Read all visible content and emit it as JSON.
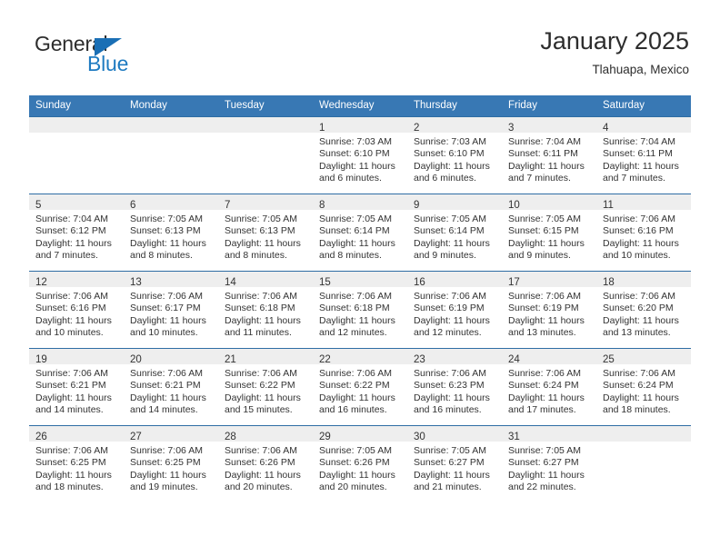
{
  "brand": {
    "logo_top": "General",
    "logo_bottom": "Blue",
    "accent_color": "#1f7bc1",
    "triangle_color": "#1a6fb5",
    "triangle_icon": "triangle-icon"
  },
  "header": {
    "title": "January 2025",
    "subtitle": "Tlahuapa, Mexico"
  },
  "calendar": {
    "header_bg": "#3878b4",
    "header_text_color": "#ffffff",
    "daynum_band_bg": "#eeeeee",
    "row_border_color": "#2e6da4",
    "weekday_headers": [
      "Sunday",
      "Monday",
      "Tuesday",
      "Wednesday",
      "Thursday",
      "Friday",
      "Saturday"
    ],
    "weeks": [
      [
        {
          "day": "",
          "lines": []
        },
        {
          "day": "",
          "lines": []
        },
        {
          "day": "",
          "lines": []
        },
        {
          "day": "1",
          "lines": [
            "Sunrise: 7:03 AM",
            "Sunset: 6:10 PM",
            "Daylight: 11 hours",
            "and 6 minutes."
          ]
        },
        {
          "day": "2",
          "lines": [
            "Sunrise: 7:03 AM",
            "Sunset: 6:10 PM",
            "Daylight: 11 hours",
            "and 6 minutes."
          ]
        },
        {
          "day": "3",
          "lines": [
            "Sunrise: 7:04 AM",
            "Sunset: 6:11 PM",
            "Daylight: 11 hours",
            "and 7 minutes."
          ]
        },
        {
          "day": "4",
          "lines": [
            "Sunrise: 7:04 AM",
            "Sunset: 6:11 PM",
            "Daylight: 11 hours",
            "and 7 minutes."
          ]
        }
      ],
      [
        {
          "day": "5",
          "lines": [
            "Sunrise: 7:04 AM",
            "Sunset: 6:12 PM",
            "Daylight: 11 hours",
            "and 7 minutes."
          ]
        },
        {
          "day": "6",
          "lines": [
            "Sunrise: 7:05 AM",
            "Sunset: 6:13 PM",
            "Daylight: 11 hours",
            "and 8 minutes."
          ]
        },
        {
          "day": "7",
          "lines": [
            "Sunrise: 7:05 AM",
            "Sunset: 6:13 PM",
            "Daylight: 11 hours",
            "and 8 minutes."
          ]
        },
        {
          "day": "8",
          "lines": [
            "Sunrise: 7:05 AM",
            "Sunset: 6:14 PM",
            "Daylight: 11 hours",
            "and 8 minutes."
          ]
        },
        {
          "day": "9",
          "lines": [
            "Sunrise: 7:05 AM",
            "Sunset: 6:14 PM",
            "Daylight: 11 hours",
            "and 9 minutes."
          ]
        },
        {
          "day": "10",
          "lines": [
            "Sunrise: 7:05 AM",
            "Sunset: 6:15 PM",
            "Daylight: 11 hours",
            "and 9 minutes."
          ]
        },
        {
          "day": "11",
          "lines": [
            "Sunrise: 7:06 AM",
            "Sunset: 6:16 PM",
            "Daylight: 11 hours",
            "and 10 minutes."
          ]
        }
      ],
      [
        {
          "day": "12",
          "lines": [
            "Sunrise: 7:06 AM",
            "Sunset: 6:16 PM",
            "Daylight: 11 hours",
            "and 10 minutes."
          ]
        },
        {
          "day": "13",
          "lines": [
            "Sunrise: 7:06 AM",
            "Sunset: 6:17 PM",
            "Daylight: 11 hours",
            "and 10 minutes."
          ]
        },
        {
          "day": "14",
          "lines": [
            "Sunrise: 7:06 AM",
            "Sunset: 6:18 PM",
            "Daylight: 11 hours",
            "and 11 minutes."
          ]
        },
        {
          "day": "15",
          "lines": [
            "Sunrise: 7:06 AM",
            "Sunset: 6:18 PM",
            "Daylight: 11 hours",
            "and 12 minutes."
          ]
        },
        {
          "day": "16",
          "lines": [
            "Sunrise: 7:06 AM",
            "Sunset: 6:19 PM",
            "Daylight: 11 hours",
            "and 12 minutes."
          ]
        },
        {
          "day": "17",
          "lines": [
            "Sunrise: 7:06 AM",
            "Sunset: 6:19 PM",
            "Daylight: 11 hours",
            "and 13 minutes."
          ]
        },
        {
          "day": "18",
          "lines": [
            "Sunrise: 7:06 AM",
            "Sunset: 6:20 PM",
            "Daylight: 11 hours",
            "and 13 minutes."
          ]
        }
      ],
      [
        {
          "day": "19",
          "lines": [
            "Sunrise: 7:06 AM",
            "Sunset: 6:21 PM",
            "Daylight: 11 hours",
            "and 14 minutes."
          ]
        },
        {
          "day": "20",
          "lines": [
            "Sunrise: 7:06 AM",
            "Sunset: 6:21 PM",
            "Daylight: 11 hours",
            "and 14 minutes."
          ]
        },
        {
          "day": "21",
          "lines": [
            "Sunrise: 7:06 AM",
            "Sunset: 6:22 PM",
            "Daylight: 11 hours",
            "and 15 minutes."
          ]
        },
        {
          "day": "22",
          "lines": [
            "Sunrise: 7:06 AM",
            "Sunset: 6:22 PM",
            "Daylight: 11 hours",
            "and 16 minutes."
          ]
        },
        {
          "day": "23",
          "lines": [
            "Sunrise: 7:06 AM",
            "Sunset: 6:23 PM",
            "Daylight: 11 hours",
            "and 16 minutes."
          ]
        },
        {
          "day": "24",
          "lines": [
            "Sunrise: 7:06 AM",
            "Sunset: 6:24 PM",
            "Daylight: 11 hours",
            "and 17 minutes."
          ]
        },
        {
          "day": "25",
          "lines": [
            "Sunrise: 7:06 AM",
            "Sunset: 6:24 PM",
            "Daylight: 11 hours",
            "and 18 minutes."
          ]
        }
      ],
      [
        {
          "day": "26",
          "lines": [
            "Sunrise: 7:06 AM",
            "Sunset: 6:25 PM",
            "Daylight: 11 hours",
            "and 18 minutes."
          ]
        },
        {
          "day": "27",
          "lines": [
            "Sunrise: 7:06 AM",
            "Sunset: 6:25 PM",
            "Daylight: 11 hours",
            "and 19 minutes."
          ]
        },
        {
          "day": "28",
          "lines": [
            "Sunrise: 7:06 AM",
            "Sunset: 6:26 PM",
            "Daylight: 11 hours",
            "and 20 minutes."
          ]
        },
        {
          "day": "29",
          "lines": [
            "Sunrise: 7:05 AM",
            "Sunset: 6:26 PM",
            "Daylight: 11 hours",
            "and 20 minutes."
          ]
        },
        {
          "day": "30",
          "lines": [
            "Sunrise: 7:05 AM",
            "Sunset: 6:27 PM",
            "Daylight: 11 hours",
            "and 21 minutes."
          ]
        },
        {
          "day": "31",
          "lines": [
            "Sunrise: 7:05 AM",
            "Sunset: 6:27 PM",
            "Daylight: 11 hours",
            "and 22 minutes."
          ]
        },
        {
          "day": "",
          "lines": []
        }
      ]
    ]
  }
}
